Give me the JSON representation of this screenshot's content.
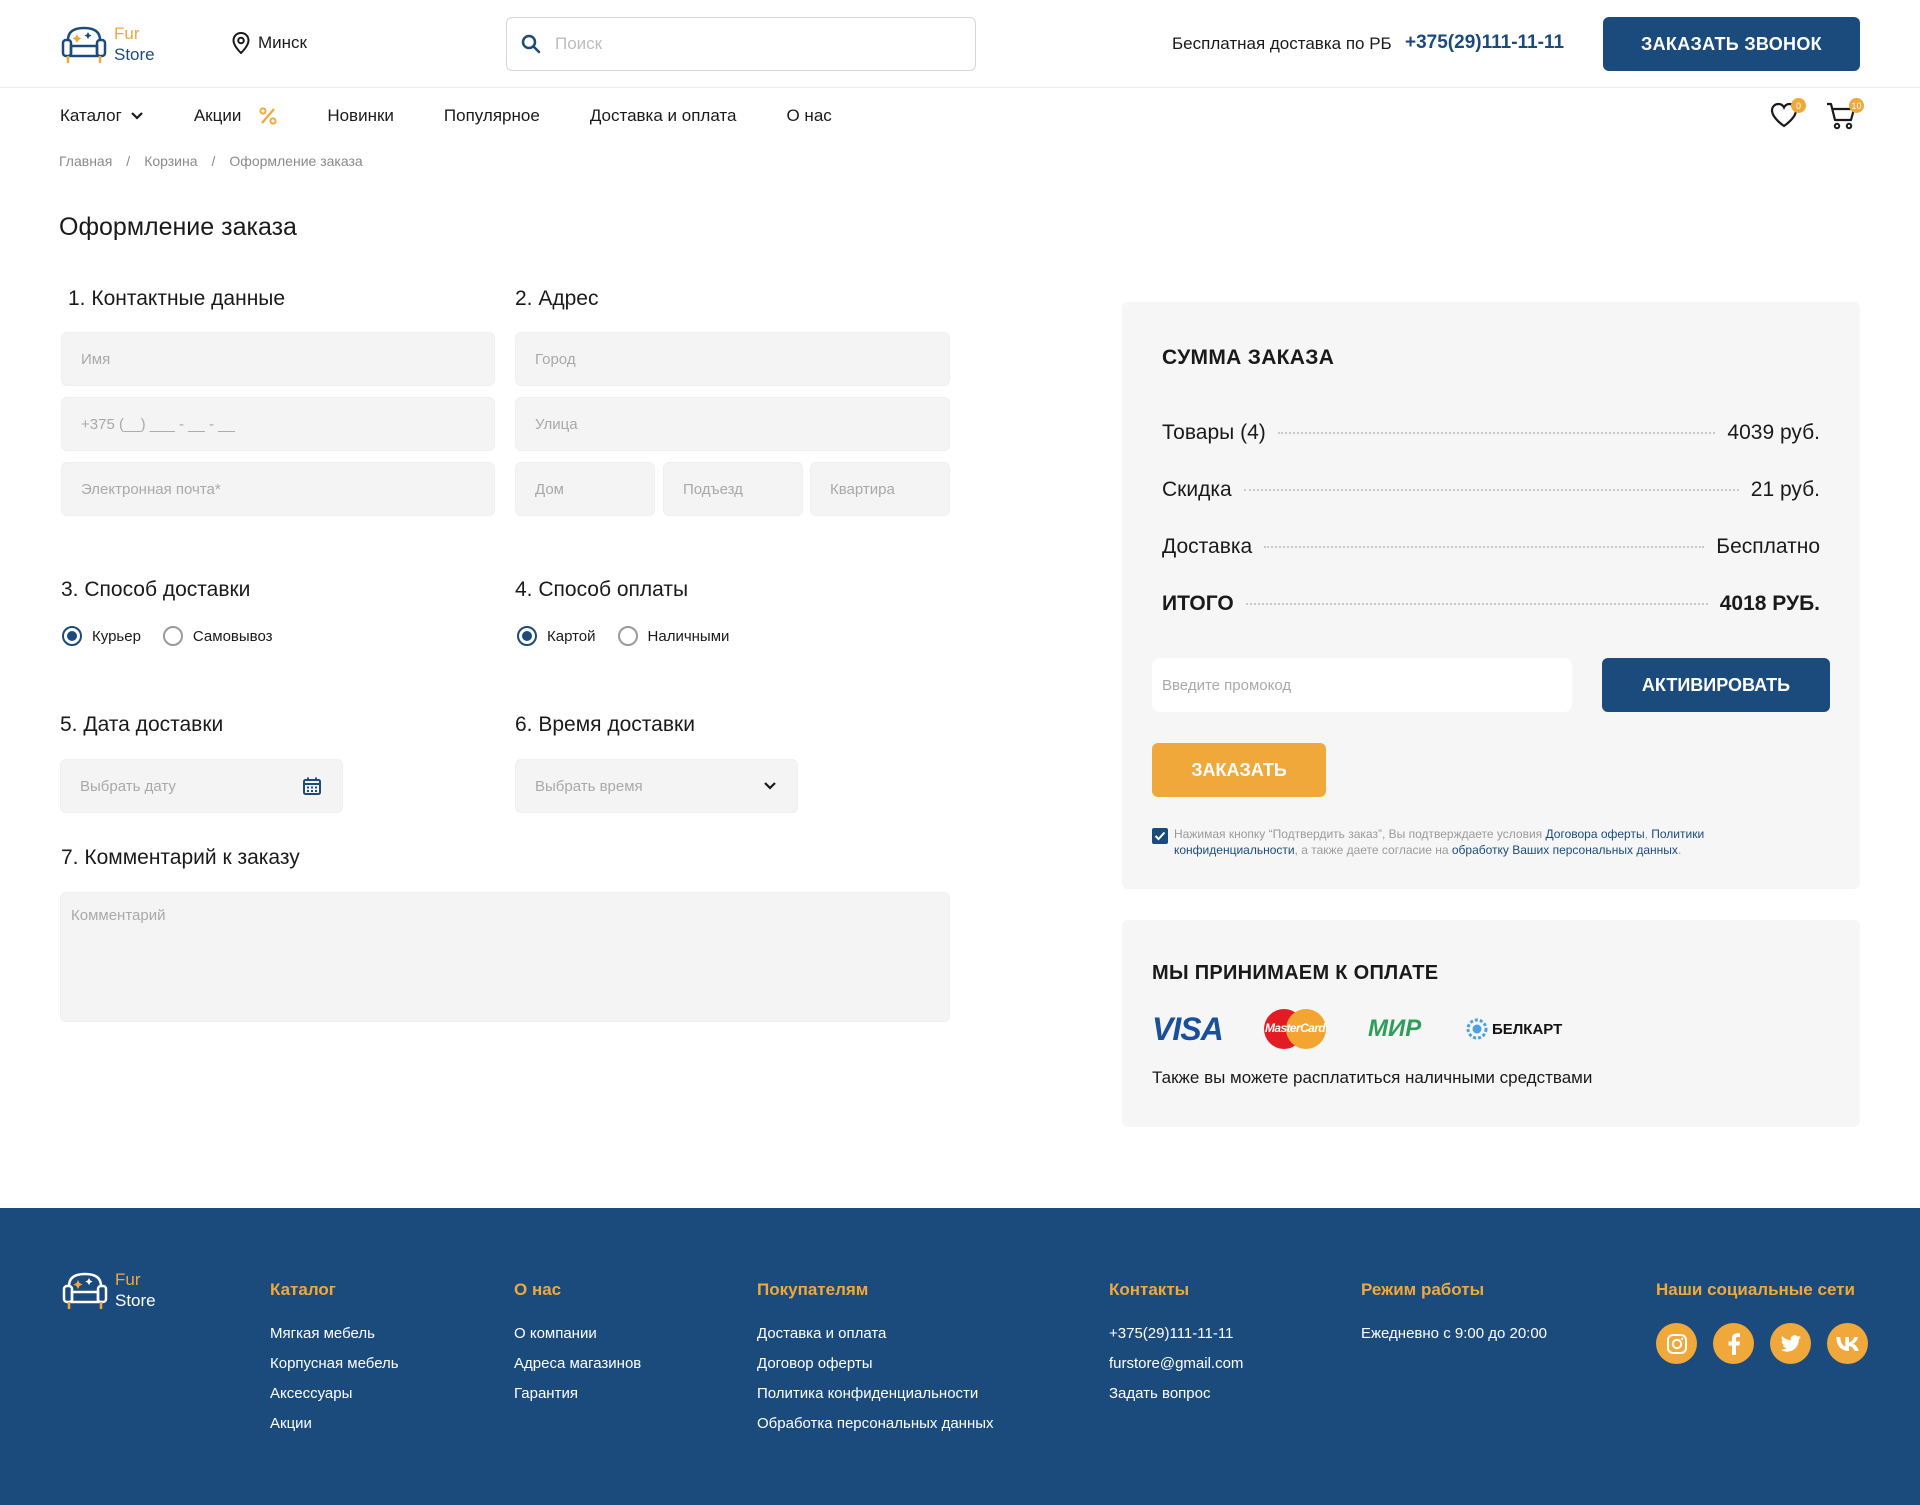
{
  "header": {
    "logo": {
      "line1": "Fur",
      "line2": "Store"
    },
    "city": "Минск",
    "search_placeholder": "Поиск",
    "delivery_note": "Бесплатная доставка по РБ",
    "phone": "+375(29)111-11-11",
    "callback_button": "ЗАКАЗАТЬ ЗВОНОК"
  },
  "nav": {
    "items": [
      "Каталог",
      "Акции",
      "Новинки",
      "Популярное",
      "Доставка и оплата",
      "О нас"
    ],
    "favorites_count": "0",
    "cart_count": "10"
  },
  "breadcrumb": [
    "Главная",
    "Корзина",
    "Оформление заказа"
  ],
  "page_title": "Оформление заказа",
  "sections": {
    "contacts": "1. Контактные данные",
    "address": "2. Адрес",
    "delivery_method": "3. Способ доставки",
    "payment_method": "4. Способ оплаты",
    "delivery_date": "5. Дата доставки",
    "delivery_time": "6. Время доставки",
    "comment": "7. Комментарий к заказу"
  },
  "form": {
    "name_placeholder": "Имя",
    "phone_placeholder": "+375 (__) ___ - __ - __",
    "email_placeholder": "Электронная почта*",
    "city_placeholder": "Город",
    "street_placeholder": "Улица",
    "house_placeholder": "Дом",
    "entrance_placeholder": "Подъезд",
    "apartment_placeholder": "Квартира",
    "delivery_options": [
      {
        "label": "Курьер",
        "selected": true
      },
      {
        "label": "Самовывоз",
        "selected": false
      }
    ],
    "payment_options": [
      {
        "label": "Картой",
        "selected": true
      },
      {
        "label": "Наличными",
        "selected": false
      }
    ],
    "date_placeholder": "Выбрать дату",
    "time_placeholder": "Выбрать время",
    "comment_placeholder": "Комментарий"
  },
  "summary": {
    "title": "СУММА ЗАКАЗА",
    "rows": [
      {
        "label": "Товары (4)",
        "value": "4039 руб."
      },
      {
        "label": "Скидка",
        "value": "21 руб."
      },
      {
        "label": "Доставка",
        "value": "Бесплатно"
      },
      {
        "label": "ИТОГО",
        "value": "4018 РУБ."
      }
    ],
    "promo_placeholder": "Введите промокод",
    "activate_button": "АКТИВИРОВАТЬ",
    "order_button": "ЗАКАЗАТЬ",
    "consent": {
      "checked": true,
      "text1": "Нажимая кнопку “Подтвердить заказ”, Вы подтверждаете условия ",
      "link1": "Договора оферты",
      "sep1": ", ",
      "link2": "Политики конфиденциальности",
      "text2": ", а также даете согласие на  ",
      "link3": "обработку Ваших персональных данных",
      "text3": "."
    }
  },
  "payment": {
    "title": "МЫ ПРИНИМАЕМ К ОПЛАТЕ",
    "logos": [
      "VISA",
      "MasterCard",
      "МИР",
      "БЕЛКАРТ"
    ],
    "note": "Также вы можете расплатиться наличными средствами"
  },
  "footer": {
    "logo": {
      "line1": "Fur",
      "line2": "Store"
    },
    "columns": [
      {
        "title": "Каталог",
        "links": [
          "Мягкая мебель",
          "Корпусная мебель",
          "Аксессуары",
          "Акции"
        ]
      },
      {
        "title": "О нас",
        "links": [
          "О компании",
          "Адреса магазинов",
          "Гарантия"
        ]
      },
      {
        "title": "Покупателям",
        "links": [
          "Доставка и оплата",
          "Договор оферты",
          "Политика конфиденциальности",
          "Обработка персональных данных"
        ]
      },
      {
        "title": "Контакты",
        "links": [
          "+375(29)111-11-11",
          "furstore@gmail.com",
          "Задать вопрос"
        ]
      },
      {
        "title": "Режим работы",
        "links": [
          "Ежедневно с 9:00 до 20:00"
        ]
      }
    ],
    "social_title": "Наши социальные сети",
    "social": [
      "instagram-icon",
      "facebook-icon",
      "twitter-icon",
      "vk-icon"
    ]
  },
  "colors": {
    "primary": "#1b4b7c",
    "accent": "#f0a83a",
    "field_bg": "#f4f4f4",
    "panel_bg": "#f6f6f6"
  }
}
